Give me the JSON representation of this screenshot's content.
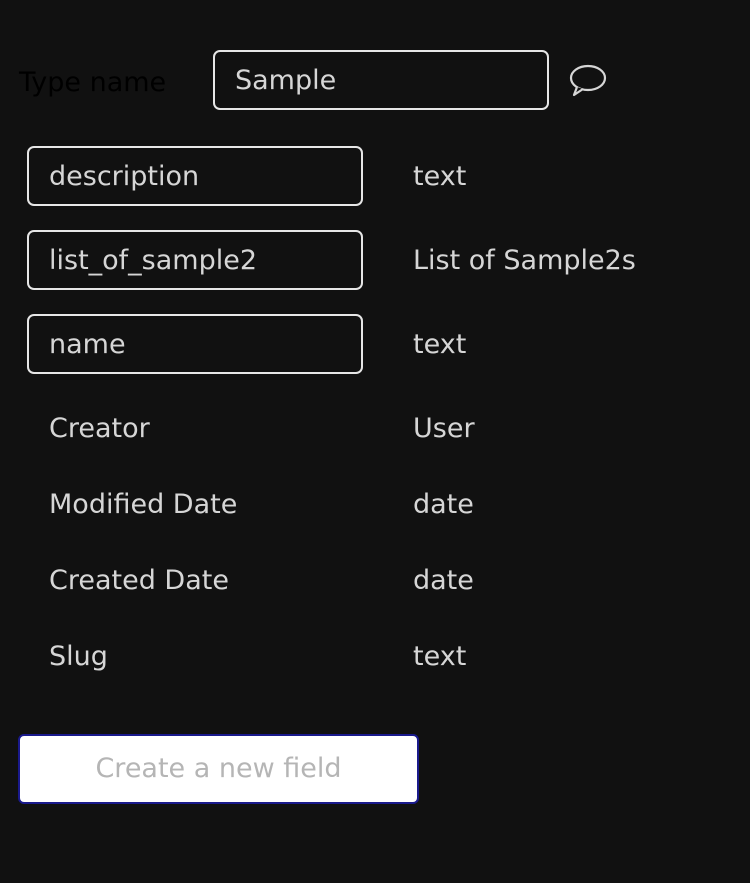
{
  "header": {
    "type_name_label": "Type name",
    "type_name_value": "Sample",
    "comment_icon": "speech-bubble-icon"
  },
  "custom_fields": [
    {
      "name": "description",
      "type": "text"
    },
    {
      "name": "list_of_sample2",
      "type": "List of Sample2s"
    },
    {
      "name": "name",
      "type": "text"
    }
  ],
  "builtin_fields": [
    {
      "name": "Creator",
      "type": "User"
    },
    {
      "name": "Modified Date",
      "type": "date"
    },
    {
      "name": "Created Date",
      "type": "date"
    },
    {
      "name": "Slug",
      "type": "text"
    }
  ],
  "create_button": {
    "label": "Create a new field"
  },
  "colors": {
    "background": "#111111",
    "text": "#d6d6d6",
    "input_border": "#e6e6e6",
    "button_border": "#1a1a8c",
    "button_text": "#b5b5b5"
  }
}
